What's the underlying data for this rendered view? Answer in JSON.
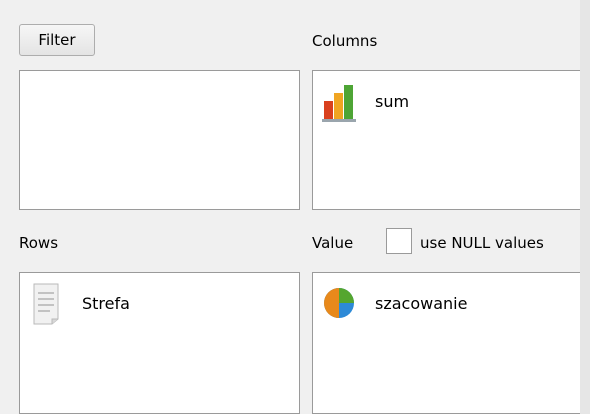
{
  "filter": {
    "button_label": "Filter"
  },
  "columns": {
    "label": "Columns",
    "items": [
      {
        "label": "sum",
        "icon": "bar-chart-icon"
      }
    ]
  },
  "rows": {
    "label": "Rows",
    "items": [
      {
        "label": "Strefa",
        "icon": "document-icon"
      }
    ]
  },
  "value": {
    "label": "Value",
    "use_null_label": "use NULL values",
    "use_null_checked": false,
    "items": [
      {
        "label": "szacowanie",
        "icon": "pie-chart-icon"
      }
    ]
  },
  "colors": {
    "pie_orange": "#e8891b",
    "pie_green": "#55a62f",
    "pie_blue": "#2d8ad7",
    "bar_red": "#d9401e",
    "bar_orange": "#f0a522",
    "bar_green": "#4ea535"
  }
}
